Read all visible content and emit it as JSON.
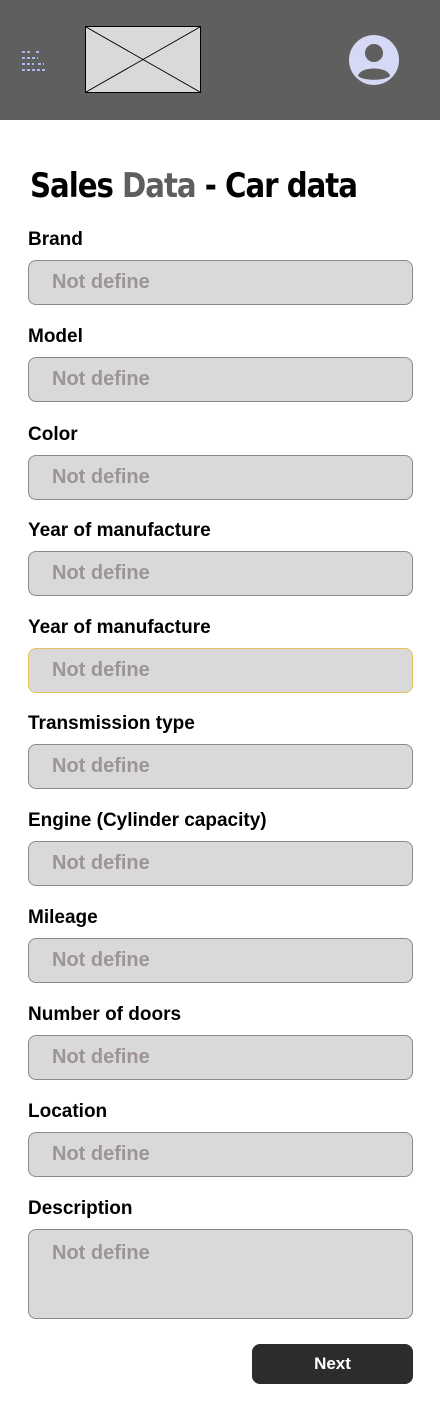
{
  "header": {
    "menu_icon": "menu-icon",
    "logo_icon": "image-placeholder-icon",
    "avatar_icon": "user-avatar-icon"
  },
  "page": {
    "title_part1": "Sales ",
    "title_part2": "Data",
    "title_part3": " - Car data"
  },
  "form": {
    "fields": [
      {
        "label": "Brand",
        "placeholder": "Not define",
        "value": ""
      },
      {
        "label": "Model",
        "placeholder": "Not define",
        "value": ""
      },
      {
        "label": "Color",
        "placeholder": "Not define",
        "value": ""
      },
      {
        "label": "Year of manufacture",
        "placeholder": "Not define",
        "value": ""
      },
      {
        "label": "Year of manufacture",
        "placeholder": "Not define",
        "value": "",
        "state": "focused"
      },
      {
        "label": "Transmission type",
        "placeholder": "Not define",
        "value": ""
      },
      {
        "label": "Engine (Cylinder capacity)",
        "placeholder": "Not define",
        "value": ""
      },
      {
        "label": "Mileage",
        "placeholder": "Not define",
        "value": ""
      },
      {
        "label": "Number of doors",
        "placeholder": "Not define",
        "value": ""
      },
      {
        "label": "Location",
        "placeholder": "Not define",
        "value": ""
      }
    ],
    "description": {
      "label": "Description",
      "placeholder": "Not define",
      "value": ""
    },
    "next_label": "Next"
  },
  "colors": {
    "header_bg": "#5f5f5f",
    "input_bg": "#d9d9d9",
    "focus_border": "#e6c35a",
    "button_bg": "#2c2c2c",
    "avatar": "#d6d9f5"
  }
}
